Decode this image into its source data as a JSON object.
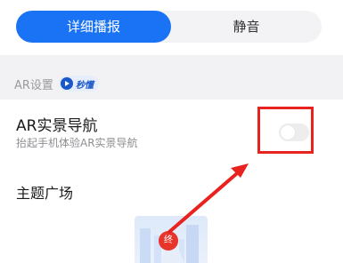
{
  "broadcast_mode": {
    "options": [
      "详细播报",
      "静音"
    ],
    "selected": "详细播报"
  },
  "ar_section": {
    "title": "AR设置",
    "badge": "秒懂",
    "ar_navigation": {
      "title": "AR实景导航",
      "subtitle": "抬起手机体验AR实景导航",
      "enabled": false
    }
  },
  "theme": {
    "title": "主题广场",
    "pin_label": "终"
  },
  "colors": {
    "accent": "#1a73f5",
    "annotation": "#e8231f"
  }
}
